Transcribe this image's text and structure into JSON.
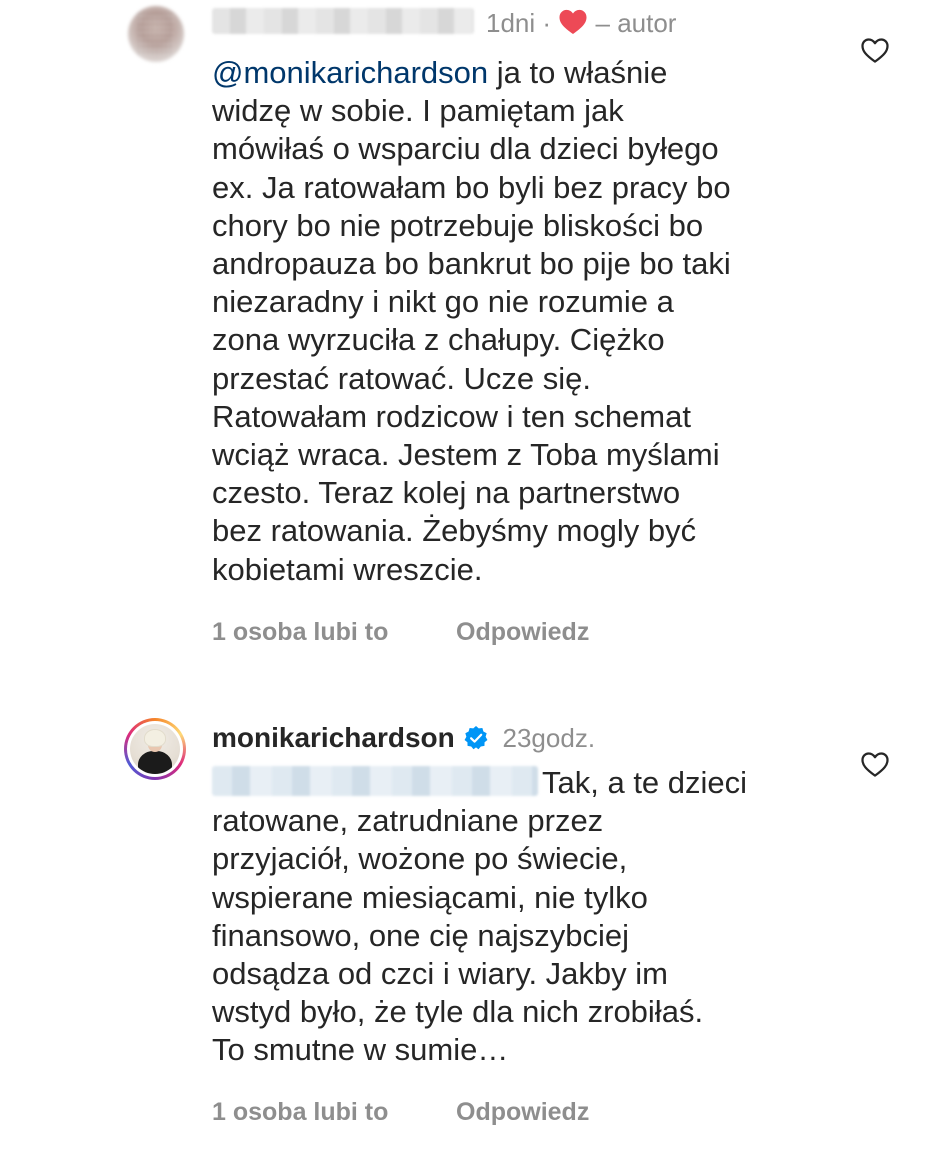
{
  "comments": [
    {
      "author_name": "",
      "time": "1dni",
      "author_like_label": "– autor",
      "mention": "@monikarichardson",
      "text": " ja to właśnie\nwidzę w sobie. I pamiętam jak\nmówiłaś o wsparciu dla dzieci byłego\nex. Ja ratowałam bo byli bez pracy bo\nchory bo nie potrzebuje bliskości bo\nandropauza bo bankrut bo pije bo taki\nniezaradny i nikt go nie rozumie a\nzona wyrzuciła z chałupy. Ciężko\nprzestać ratować. Ucze się.\nRatowałam rodzicow i ten schemat\nwciąż wraca. Jestem z Toba myślami\nczesto. Teraz kolej na partnerstwo\nbez ratowania. Żebyśmy mogly być\nkobietami wreszcie.",
      "likes": "1 osoba lubi to",
      "reply": "Odpowiedz",
      "icons": {
        "author_like": "filled-heart-icon",
        "like": "heart-outline-icon"
      },
      "colors": {
        "heart": "#ed4956",
        "mention": "#00376b"
      }
    },
    {
      "author_name": "monikarichardson",
      "verified": true,
      "time": "23godz.",
      "text": "Tak, a te dzieci\nratowane, zatrudniane przez\nprzyjaciół, wożone po świecie,\nwspierane miesiącami, nie tylko\nfinansowo, one cię najszybciej\nodsądza od czci i wiary. Jakby im\nwstyd było, że tyle dla nich zrobiłaś.\nTo smutne w sumie…",
      "likes": "1 osoba lubi to",
      "reply": "Odpowiedz",
      "icons": {
        "verified": "verified-badge-icon",
        "like": "heart-outline-icon"
      },
      "colors": {
        "verified": "#0095f6"
      }
    }
  ]
}
